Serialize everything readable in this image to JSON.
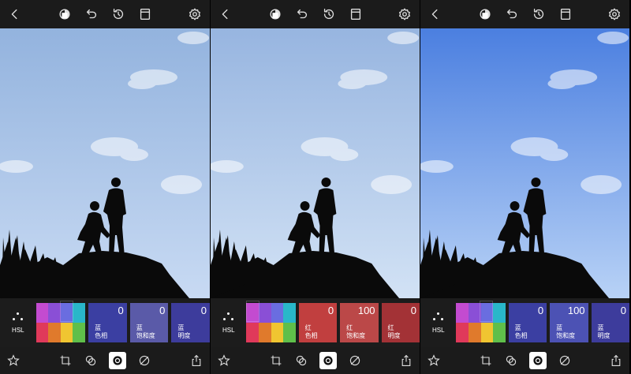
{
  "panels": [
    {
      "hsl_label": "HSL",
      "cards": [
        {
          "value": "0",
          "label_line1": "蓝",
          "label_line2": "色相",
          "color": "#3b3fa2"
        },
        {
          "value": "0",
          "label_line1": "蓝",
          "label_line2": "饱和度",
          "color": "#5a5aa8"
        },
        {
          "value": "0",
          "label_line1": "蓝",
          "label_line2": "明度",
          "color": "#3d3c9c"
        }
      ],
      "sky": [
        "#93b3de",
        "#c8daf3"
      ]
    },
    {
      "hsl_label": "HSL",
      "cards": [
        {
          "value": "0",
          "label_line1": "红",
          "label_line2": "色相",
          "color": "#c13f3f"
        },
        {
          "value": "100",
          "label_line1": "红",
          "label_line2": "饱和度",
          "color": "#bb4848"
        },
        {
          "value": "0",
          "label_line1": "红",
          "label_line2": "明度",
          "color": "#a33236"
        }
      ],
      "sky": [
        "#97b5e0",
        "#d2e2f5"
      ]
    },
    {
      "hsl_label": "HSL",
      "cards": [
        {
          "value": "0",
          "label_line1": "蓝",
          "label_line2": "色相",
          "color": "#3b3fa2"
        },
        {
          "value": "100",
          "label_line1": "蓝",
          "label_line2": "饱和度",
          "color": "#4c52b4"
        },
        {
          "value": "0",
          "label_line1": "蓝",
          "label_line2": "明度",
          "color": "#3d3c9c"
        }
      ],
      "sky": [
        "#4b7fe0",
        "#b8d2f6"
      ]
    }
  ],
  "colors": {
    "toolbar_bg": "#1b1b1b",
    "icon": "#dddddd",
    "swatches": [
      "#c34bd0",
      "#8a4fd6",
      "#6a6de0",
      "#29b7c9",
      "#e0395a",
      "#e07a2c",
      "#f0c531",
      "#5fbf4a"
    ]
  }
}
